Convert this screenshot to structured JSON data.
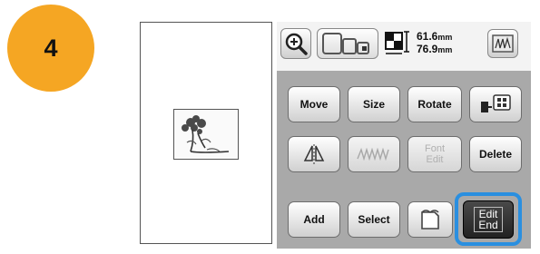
{
  "step": {
    "number": "4"
  },
  "toolbar": {
    "width_value": "61.6",
    "width_unit": "mm",
    "height_value": "76.9",
    "height_unit": "mm"
  },
  "buttons": {
    "move": "Move",
    "size": "Size",
    "rotate": "Rotate",
    "font_edit": "Font Edit",
    "delete": "Delete",
    "add": "Add",
    "select": "Select",
    "edit_end_line1": "Edit",
    "edit_end_line2": "End"
  },
  "colors": {
    "badge": "#f5a623",
    "highlight": "#2a8fe0",
    "panel_grey": "#a9a9a9"
  }
}
